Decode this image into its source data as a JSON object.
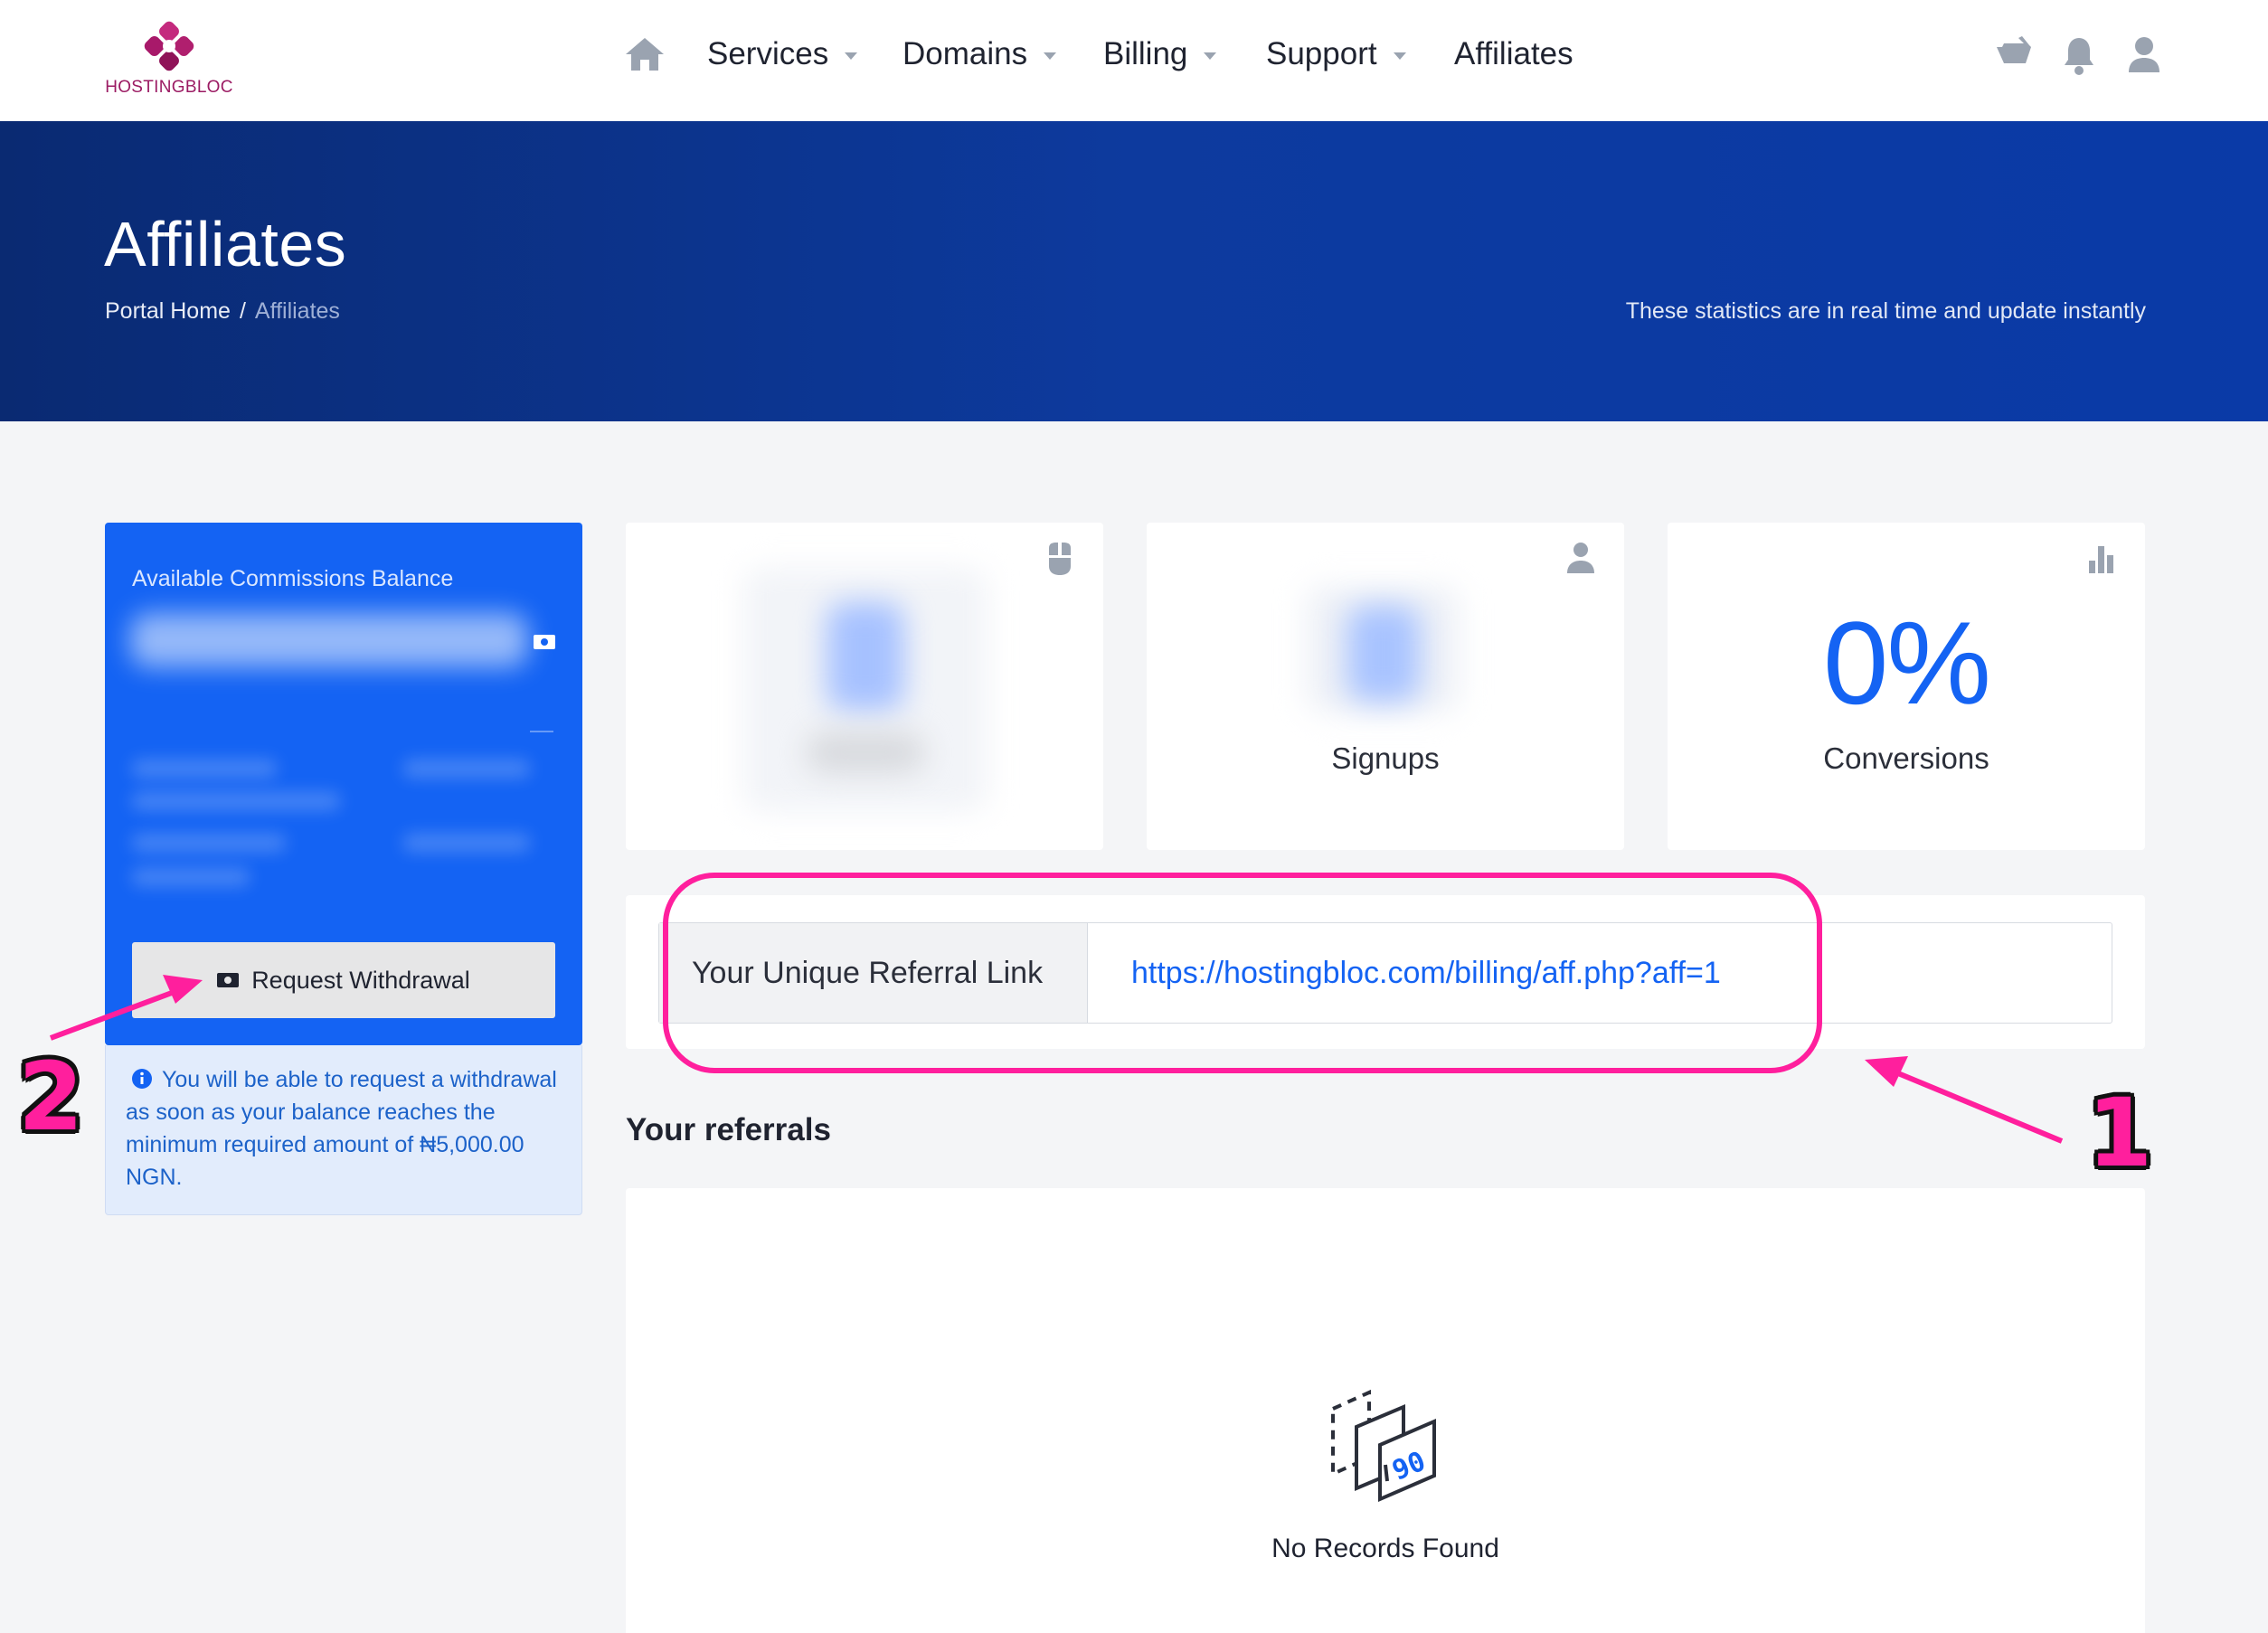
{
  "brand": {
    "name": "HOSTINGBLOC",
    "color": "#9b1b63"
  },
  "nav": {
    "items": [
      {
        "label": "Services",
        "has_caret": true
      },
      {
        "label": "Domains",
        "has_caret": true
      },
      {
        "label": "Billing",
        "has_caret": true
      },
      {
        "label": "Support",
        "has_caret": true
      },
      {
        "label": "Affiliates",
        "has_caret": false
      }
    ],
    "icons": [
      "home-icon",
      "cart-icon",
      "bell-icon",
      "user-icon"
    ]
  },
  "hero": {
    "title": "Affiliates",
    "breadcrumb": {
      "home": "Portal Home",
      "separator": "/",
      "current": "Affiliates"
    },
    "note": "These statistics are in real time and update instantly"
  },
  "balance": {
    "label": "Available Commissions Balance",
    "withdraw_label": "Request Withdrawal",
    "info": "You will be able to request a withdrawal as soon as your balance reaches the minimum required amount of ₦5,000.00 NGN."
  },
  "stats": {
    "clicks_icon": "mouse-icon",
    "signups_label": "Signups",
    "signups_icon": "user-icon",
    "conversions_value": "0%",
    "conversions_label": "Conversions",
    "conversions_icon": "bar-chart-icon"
  },
  "referral": {
    "label": "Your Unique Referral Link",
    "url": "https://hostingbloc.com/billing/aff.php?aff=1"
  },
  "referrals": {
    "title": "Your referrals",
    "empty_text": "No Records Found",
    "empty_icon": "no-records-icon"
  },
  "annotations": {
    "callout_1": "1",
    "callout_2": "2",
    "color": "#ff1f9d"
  },
  "colors": {
    "accent": "#1463f3",
    "hero": "#0a2a72",
    "page_bg": "#f4f5f7"
  }
}
